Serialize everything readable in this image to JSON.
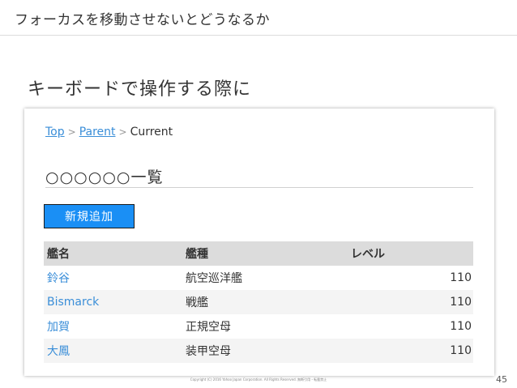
{
  "slide": {
    "title": "フォーカスを移動させないとどうなるか",
    "section_heading": "キーボードで操作する際に",
    "copyright": "Copyright (C) 2016 Yahoo Japan Corporation. All Rights Reserved. 無断引用・転載禁止",
    "page_number": "45"
  },
  "mock": {
    "breadcrumb": {
      "items": [
        "Top",
        "Parent",
        "Current"
      ],
      "separator": ">"
    },
    "page_title": "○○○○○○一覧",
    "add_button_label": "新規追加",
    "table": {
      "headers": [
        "艦名",
        "艦種",
        "レベル"
      ],
      "rows": [
        {
          "name": "鈴谷",
          "type": "航空巡洋艦",
          "level": "110"
        },
        {
          "name": "Bismarck",
          "type": "戦艦",
          "level": "110"
        },
        {
          "name": "加賀",
          "type": "正規空母",
          "level": "110"
        },
        {
          "name": "大鳳",
          "type": "装甲空母",
          "level": "110"
        }
      ]
    }
  },
  "colors": {
    "link": "#3a8ed8",
    "button": "#1a8ff5",
    "header_bg": "#dcdcdc",
    "row_alt_bg": "#f4f4f4"
  }
}
